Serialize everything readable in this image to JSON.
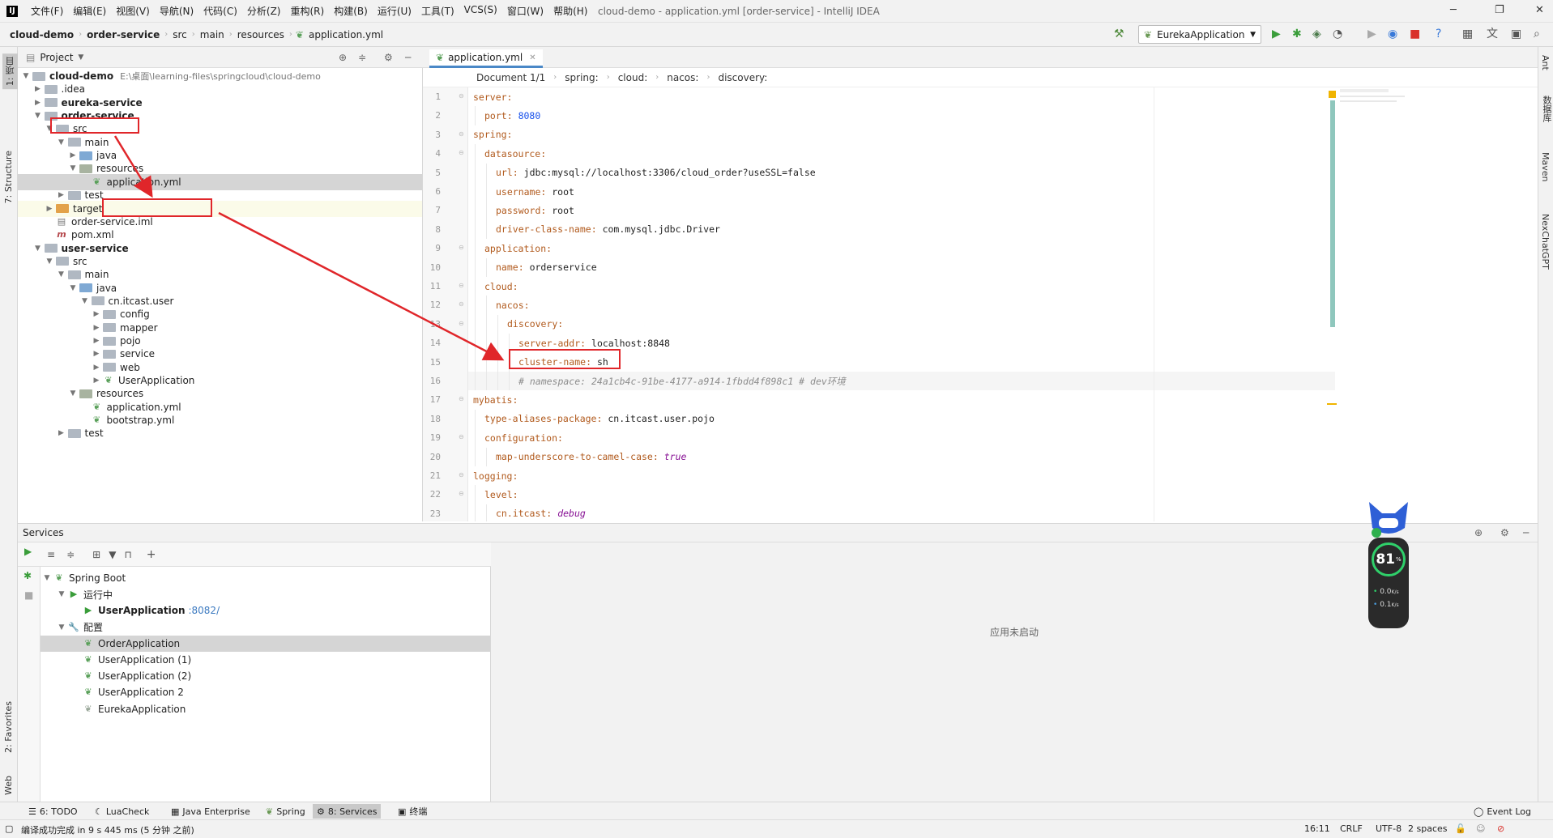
{
  "window": {
    "title": "cloud-demo - application.yml [order-service] - IntelliJ IDEA",
    "menu": [
      "文件(F)",
      "编辑(E)",
      "视图(V)",
      "导航(N)",
      "代码(C)",
      "分析(Z)",
      "重构(R)",
      "构建(B)",
      "运行(U)",
      "工具(T)",
      "VCS(S)",
      "窗口(W)",
      "帮助(H)"
    ]
  },
  "navbar": {
    "crumbs": [
      "cloud-demo",
      "order-service",
      "src",
      "main",
      "resources",
      "application.yml"
    ],
    "run_config": "EurekaApplication"
  },
  "tool_windows": {
    "left_top": [
      "1: 项目",
      "7: Structure"
    ],
    "left_bottom": [
      "2: Favorites",
      "Web"
    ],
    "right": [
      "Ant",
      "数据库",
      "Maven",
      "NexChatGPT"
    ]
  },
  "project": {
    "header": "Project",
    "root_path": "E:\\桌面\\learning-files\\springcloud\\cloud-demo",
    "tree": [
      {
        "label": "cloud-demo",
        "indent": 0,
        "arrow": "open",
        "icon": "folder",
        "bold": true
      },
      {
        "label": ".idea",
        "indent": 1,
        "arrow": "closed",
        "icon": "folder"
      },
      {
        "label": "eureka-service",
        "indent": 1,
        "arrow": "closed",
        "icon": "folder",
        "bold": true
      },
      {
        "label": "order-service",
        "indent": 1,
        "arrow": "open",
        "icon": "folder",
        "bold": true
      },
      {
        "label": "src",
        "indent": 2,
        "arrow": "open",
        "icon": "folder"
      },
      {
        "label": "main",
        "indent": 3,
        "arrow": "open",
        "icon": "folder"
      },
      {
        "label": "java",
        "indent": 4,
        "arrow": "closed",
        "icon": "folder-blue"
      },
      {
        "label": "resources",
        "indent": 4,
        "arrow": "open",
        "icon": "folder-res"
      },
      {
        "label": "application.yml",
        "indent": 5,
        "arrow": "",
        "icon": "yml",
        "selected": true
      },
      {
        "label": "test",
        "indent": 3,
        "arrow": "closed",
        "icon": "folder"
      },
      {
        "label": "target",
        "indent": 2,
        "arrow": "closed",
        "icon": "folder-orange",
        "highlight": true
      },
      {
        "label": "order-service.iml",
        "indent": 2,
        "arrow": "",
        "icon": "iml"
      },
      {
        "label": "pom.xml",
        "indent": 2,
        "arrow": "",
        "icon": "maven"
      },
      {
        "label": "user-service",
        "indent": 1,
        "arrow": "open",
        "icon": "folder",
        "bold": true
      },
      {
        "label": "src",
        "indent": 2,
        "arrow": "open",
        "icon": "folder"
      },
      {
        "label": "main",
        "indent": 3,
        "arrow": "open",
        "icon": "folder"
      },
      {
        "label": "java",
        "indent": 4,
        "arrow": "open",
        "icon": "folder-blue"
      },
      {
        "label": "cn.itcast.user",
        "indent": 5,
        "arrow": "open",
        "icon": "folder"
      },
      {
        "label": "config",
        "indent": 6,
        "arrow": "closed",
        "icon": "folder"
      },
      {
        "label": "mapper",
        "indent": 6,
        "arrow": "closed",
        "icon": "folder"
      },
      {
        "label": "pojo",
        "indent": 6,
        "arrow": "closed",
        "icon": "folder"
      },
      {
        "label": "service",
        "indent": 6,
        "arrow": "closed",
        "icon": "folder"
      },
      {
        "label": "web",
        "indent": 6,
        "arrow": "closed",
        "icon": "folder"
      },
      {
        "label": "UserApplication",
        "indent": 6,
        "arrow": "closed",
        "icon": "spring"
      },
      {
        "label": "resources",
        "indent": 4,
        "arrow": "open",
        "icon": "folder-res"
      },
      {
        "label": "application.yml",
        "indent": 5,
        "arrow": "",
        "icon": "yml"
      },
      {
        "label": "bootstrap.yml",
        "indent": 5,
        "arrow": "",
        "icon": "yml"
      },
      {
        "label": "test",
        "indent": 3,
        "arrow": "closed",
        "icon": "folder"
      }
    ]
  },
  "editor": {
    "tab": "application.yml",
    "breadcrumbs": [
      "Document 1/1",
      "spring:",
      "cloud:",
      "nacos:",
      "discovery:"
    ],
    "lines": [
      {
        "n": "1",
        "indent": 0,
        "key": "server:",
        "val": "",
        "type": ""
      },
      {
        "n": "2",
        "indent": 1,
        "key": "port:",
        "val": "8080",
        "type": "num"
      },
      {
        "n": "3",
        "indent": 0,
        "key": "spring:",
        "val": "",
        "type": ""
      },
      {
        "n": "4",
        "indent": 1,
        "key": "datasource:",
        "val": "",
        "type": ""
      },
      {
        "n": "5",
        "indent": 2,
        "key": "url:",
        "val": "jdbc:mysql://localhost:3306/cloud_order?useSSL=false",
        "type": ""
      },
      {
        "n": "6",
        "indent": 2,
        "key": "username:",
        "val": "root",
        "type": ""
      },
      {
        "n": "7",
        "indent": 2,
        "key": "password:",
        "val": "root",
        "type": ""
      },
      {
        "n": "8",
        "indent": 2,
        "key": "driver-class-name:",
        "val": "com.mysql.jdbc.Driver",
        "type": ""
      },
      {
        "n": "9",
        "indent": 1,
        "key": "application:",
        "val": "",
        "type": ""
      },
      {
        "n": "10",
        "indent": 2,
        "key": "name:",
        "val": "orderservice",
        "type": ""
      },
      {
        "n": "11",
        "indent": 1,
        "key": "cloud:",
        "val": "",
        "type": ""
      },
      {
        "n": "12",
        "indent": 2,
        "key": "nacos:",
        "val": "",
        "type": ""
      },
      {
        "n": "13",
        "indent": 3,
        "key": "discovery:",
        "val": "",
        "type": ""
      },
      {
        "n": "14",
        "indent": 4,
        "key": "server-addr:",
        "val": "localhost:8848",
        "type": ""
      },
      {
        "n": "15",
        "indent": 4,
        "key": "cluster-name:",
        "val": "sh",
        "type": ""
      },
      {
        "n": "16",
        "indent": 4,
        "key": "",
        "val": "# namespace: 24a1cb4c-91be-4177-a914-1fbdd4f898c1 # dev环境",
        "type": "comment"
      },
      {
        "n": "17",
        "indent": 0,
        "key": "mybatis:",
        "val": "",
        "type": ""
      },
      {
        "n": "18",
        "indent": 1,
        "key": "type-aliases-package:",
        "val": "cn.itcast.user.pojo",
        "type": ""
      },
      {
        "n": "19",
        "indent": 1,
        "key": "configuration:",
        "val": "",
        "type": ""
      },
      {
        "n": "20",
        "indent": 2,
        "key": "map-underscore-to-camel-case:",
        "val": "true",
        "type": "kw"
      },
      {
        "n": "21",
        "indent": 0,
        "key": "logging:",
        "val": "",
        "type": ""
      },
      {
        "n": "22",
        "indent": 1,
        "key": "level:",
        "val": "",
        "type": ""
      },
      {
        "n": "23",
        "indent": 2,
        "key": "cn.itcast:",
        "val": "debug",
        "type": "kw"
      }
    ]
  },
  "services": {
    "header": "Services",
    "tree": [
      {
        "label": "Spring Boot",
        "indent": 0,
        "arrow": "open",
        "icon": "spring"
      },
      {
        "label": "运行中",
        "indent": 1,
        "arrow": "open",
        "icon": "run"
      },
      {
        "label": "UserApplication",
        "port": ":8082/",
        "indent": 2,
        "arrow": "",
        "icon": "run",
        "bold": true
      },
      {
        "label": "配置",
        "indent": 1,
        "arrow": "open",
        "icon": "wrench"
      },
      {
        "label": "OrderApplication",
        "indent": 2,
        "arrow": "",
        "icon": "spring",
        "selected": true
      },
      {
        "label": "UserApplication (1)",
        "indent": 2,
        "arrow": "",
        "icon": "spring"
      },
      {
        "label": "UserApplication (2)",
        "indent": 2,
        "arrow": "",
        "icon": "spring"
      },
      {
        "label": "UserApplication 2",
        "indent": 2,
        "arrow": "",
        "icon": "spring"
      },
      {
        "label": "EurekaApplication",
        "indent": 2,
        "arrow": "",
        "icon": "spring-gray"
      }
    ],
    "detail_text": "应用未启动"
  },
  "widget": {
    "value": "81",
    "unit": "%",
    "up": "0.0",
    "down": "0.1",
    "rate_unit": "K/s"
  },
  "bottom_tabs": [
    "6: TODO",
    "LuaCheck",
    "Java Enterprise",
    "Spring",
    "8: Services",
    "终端"
  ],
  "event_log": "Event Log",
  "status": {
    "message": "编译成功完成 in 9 s 445 ms (5 分钟 之前)",
    "position": "16:11",
    "line_sep": "CRLF",
    "encoding": "UTF-8",
    "indent": "2 spaces"
  },
  "colors": {
    "accent": "#4a88c7",
    "annotation": "#e0262a",
    "yaml_key": "#b15a1d"
  }
}
